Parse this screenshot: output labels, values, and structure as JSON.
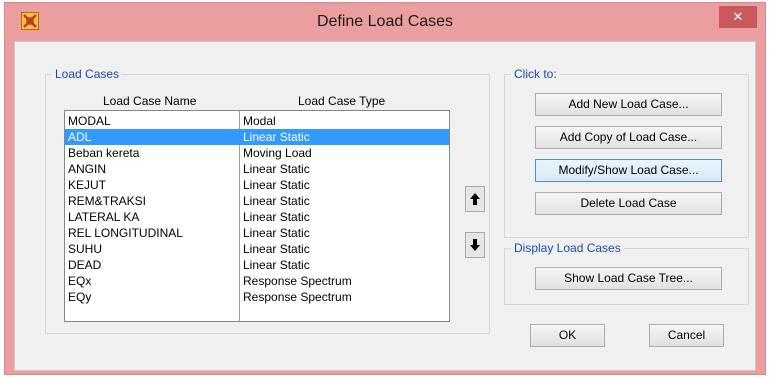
{
  "window": {
    "title": "Define Load Cases",
    "close_glyph": "✕",
    "app_icon": "sap2000-app-icon"
  },
  "load_cases": {
    "group_label": "Load Cases",
    "col_name": "Load Case Name",
    "col_type": "Load Case Type",
    "rows": [
      {
        "name": "MODAL",
        "type": "Modal",
        "selected": false
      },
      {
        "name": "ADL",
        "type": "Linear Static",
        "selected": true
      },
      {
        "name": "Beban kereta",
        "type": "Moving Load",
        "selected": false
      },
      {
        "name": "ANGIN",
        "type": "Linear Static",
        "selected": false
      },
      {
        "name": "KEJUT",
        "type": "Linear Static",
        "selected": false
      },
      {
        "name": "REM&TRAKSI",
        "type": "Linear Static",
        "selected": false
      },
      {
        "name": "LATERAL KA",
        "type": "Linear Static",
        "selected": false
      },
      {
        "name": "REL LONGITUDINAL",
        "type": "Linear Static",
        "selected": false
      },
      {
        "name": "SUHU",
        "type": "Linear Static",
        "selected": false
      },
      {
        "name": "DEAD",
        "type": "Linear Static",
        "selected": false
      },
      {
        "name": "EQx",
        "type": "Response Spectrum",
        "selected": false
      },
      {
        "name": "EQy",
        "type": "Response Spectrum",
        "selected": false
      }
    ],
    "move_up_icon": "arrow-up-icon",
    "move_down_icon": "arrow-down-icon"
  },
  "click_to": {
    "group_label": "Click to:",
    "add_new": "Add New Load Case...",
    "add_copy": "Add Copy of Load Case...",
    "modify_show": "Modify/Show Load Case...",
    "delete": "Delete Load Case"
  },
  "display": {
    "group_label": "Display Load Cases",
    "show_tree": "Show Load Case Tree..."
  },
  "footer": {
    "ok": "OK",
    "cancel": "Cancel"
  },
  "colors": {
    "titlebar": "#eb9ea0",
    "close": "#c9595c",
    "selection": "#3399ff",
    "group_title": "#1a4aa8"
  }
}
